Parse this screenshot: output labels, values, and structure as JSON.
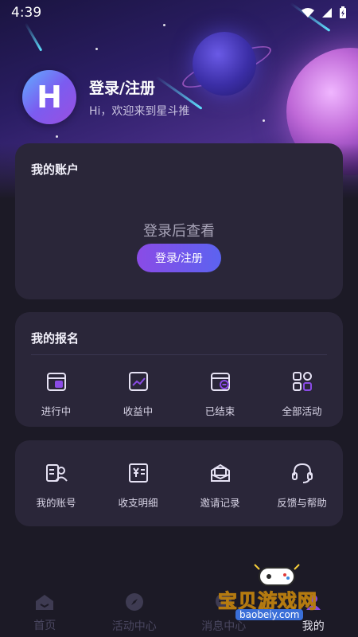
{
  "status_bar": {
    "time": "4:39"
  },
  "profile": {
    "title": "登录/注册",
    "subtitle": "Hi，欢迎来到星斗推",
    "avatar_letter": "H"
  },
  "account_card": {
    "title": "我的账户",
    "hint": "登录后查看",
    "login_button": "登录/注册"
  },
  "signup_card": {
    "title": "我的报名",
    "items": [
      {
        "label": "进行中",
        "icon": "calendar-icon"
      },
      {
        "label": "收益中",
        "icon": "chart-icon"
      },
      {
        "label": "已结束",
        "icon": "calendar-done-icon"
      },
      {
        "label": "全部活动",
        "icon": "grid-icon"
      }
    ]
  },
  "tools_card": {
    "items": [
      {
        "label": "我的账号",
        "icon": "user-card-icon"
      },
      {
        "label": "收支明细",
        "icon": "ledger-icon"
      },
      {
        "label": "邀请记录",
        "icon": "mail-icon"
      },
      {
        "label": "反馈与帮助",
        "icon": "headset-icon"
      }
    ]
  },
  "tabbar": {
    "tabs": [
      {
        "label": "首页",
        "icon": "home-icon"
      },
      {
        "label": "活动中心",
        "icon": "compass-icon"
      },
      {
        "label": "消息中心",
        "icon": "message-icon"
      },
      {
        "label": "我的",
        "icon": "user-icon",
        "active": true
      }
    ]
  },
  "watermark": {
    "text": "宝贝游戏网",
    "url": "baobeiy.com"
  },
  "colors": {
    "accent_start": "#8a4be6",
    "accent_end": "#5c63f0",
    "icon_stroke": "#e6e2f4",
    "background": "#1c1a26",
    "card": "#2a2639"
  }
}
